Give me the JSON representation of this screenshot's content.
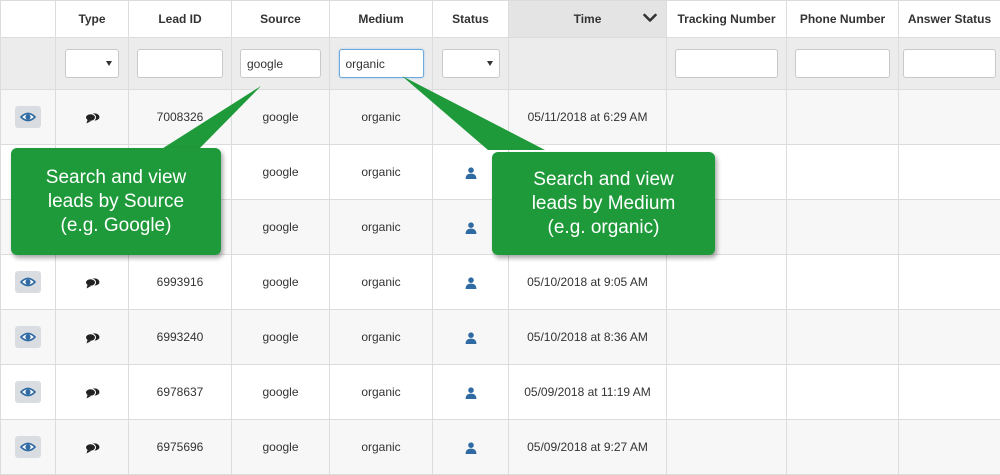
{
  "table": {
    "columns": [
      {
        "key": "view",
        "label": ""
      },
      {
        "key": "type",
        "label": "Type"
      },
      {
        "key": "lead_id",
        "label": "Lead ID"
      },
      {
        "key": "source",
        "label": "Source"
      },
      {
        "key": "medium",
        "label": "Medium"
      },
      {
        "key": "status",
        "label": "Status"
      },
      {
        "key": "time",
        "label": "Time"
      },
      {
        "key": "tracking_number",
        "label": "Tracking Number"
      },
      {
        "key": "phone_number",
        "label": "Phone Number"
      },
      {
        "key": "answer_status",
        "label": "Answer Status"
      }
    ],
    "sorted_column": "time",
    "sort_icon": "chevron-down-icon"
  },
  "filters": {
    "type": {
      "value": ""
    },
    "lead_id": {
      "value": ""
    },
    "source": {
      "value": "google"
    },
    "medium": {
      "value": "organic"
    },
    "status": {
      "value": ""
    },
    "tracking_number": {
      "value": ""
    },
    "phone_number": {
      "value": ""
    },
    "answer_status": {
      "value": ""
    }
  },
  "rows": [
    {
      "lead_id": "7008326",
      "source": "google",
      "medium": "organic",
      "status_icon": "",
      "time": "05/11/2018 at 6:29 AM"
    },
    {
      "lead_id": "",
      "source": "google",
      "medium": "organic",
      "status_icon": "user-icon",
      "time": ""
    },
    {
      "lead_id": "",
      "source": "google",
      "medium": "organic",
      "status_icon": "user-icon",
      "time": ""
    },
    {
      "lead_id": "6993916",
      "source": "google",
      "medium": "organic",
      "status_icon": "user-icon",
      "time": "05/10/2018 at 9:05 AM"
    },
    {
      "lead_id": "6993240",
      "source": "google",
      "medium": "organic",
      "status_icon": "user-icon",
      "time": "05/10/2018 at 8:36 AM"
    },
    {
      "lead_id": "6978637",
      "source": "google",
      "medium": "organic",
      "status_icon": "user-icon",
      "time": "05/09/2018 at 11:19 AM"
    },
    {
      "lead_id": "6975696",
      "source": "google",
      "medium": "organic",
      "status_icon": "user-icon",
      "time": "05/09/2018 at 9:27 AM"
    }
  ],
  "row_icons": {
    "view": "eye-icon",
    "type": "chat-bubbles-icon"
  },
  "callouts": {
    "source": "Search and view\nleads by Source\n(e.g. Google)",
    "medium": "Search and view\nleads by Medium\n(e.g. organic)"
  },
  "colors": {
    "callout_bg": "#1f9a3a",
    "icon_blue": "#2f6aa3",
    "sorted_header_bg": "#e4e4e4",
    "filter_row_bg": "#ececec"
  }
}
